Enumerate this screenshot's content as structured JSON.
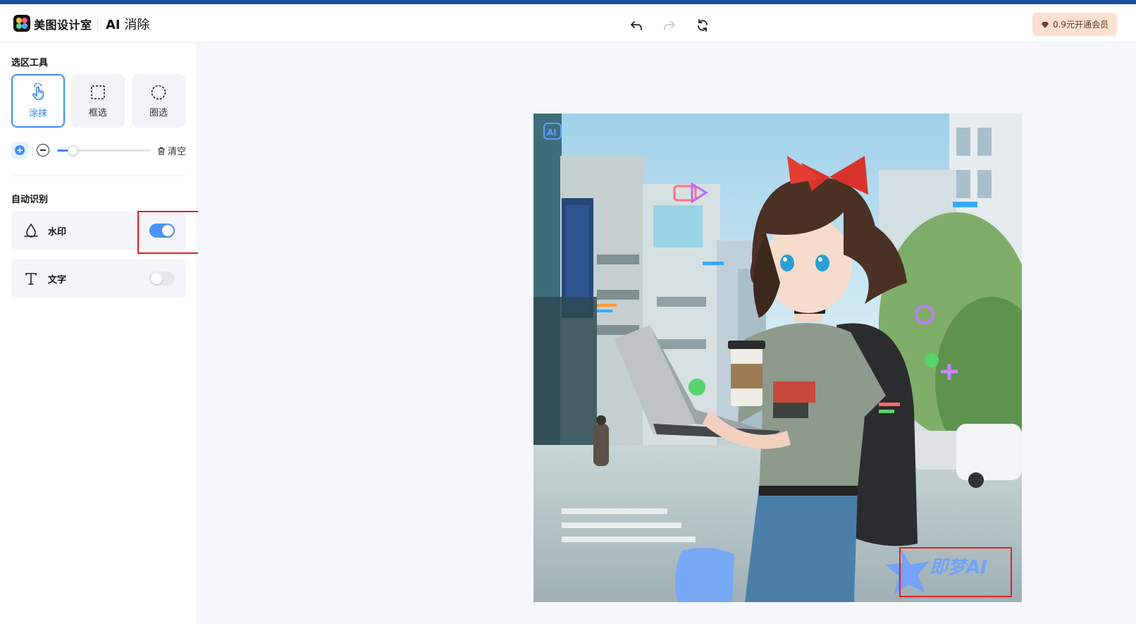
{
  "header": {
    "brand": "美图设计室",
    "product_ai": "AI",
    "product_rest": "消除",
    "vip_label": "0.9元开通会员",
    "undo_icon": "undo-icon",
    "redo_icon": "redo-icon",
    "reset_icon": "refresh-icon"
  },
  "sidebar": {
    "selection_title": "选区工具",
    "tools": [
      {
        "label": "涂抹",
        "icon": "hand-brush-icon",
        "active": true
      },
      {
        "label": "框选",
        "icon": "rect-select-icon",
        "active": false
      },
      {
        "label": "圈选",
        "icon": "lasso-select-icon",
        "active": false
      }
    ],
    "brush": {
      "size_fraction": 0.17
    },
    "clear_label": "清空",
    "auto_title": "自动识别",
    "auto_items": [
      {
        "label": "水印",
        "icon": "watermark-icon",
        "enabled": true
      },
      {
        "label": "文字",
        "icon": "text-icon",
        "enabled": false
      }
    ]
  },
  "canvas": {
    "watermark_text": "即梦AI",
    "corner_badge": "AI"
  },
  "colors": {
    "accent": "#3b8bfa",
    "top_bar": "#1c4f9c",
    "vip_bg": "#fde0cf",
    "highlight": "#e02020"
  }
}
